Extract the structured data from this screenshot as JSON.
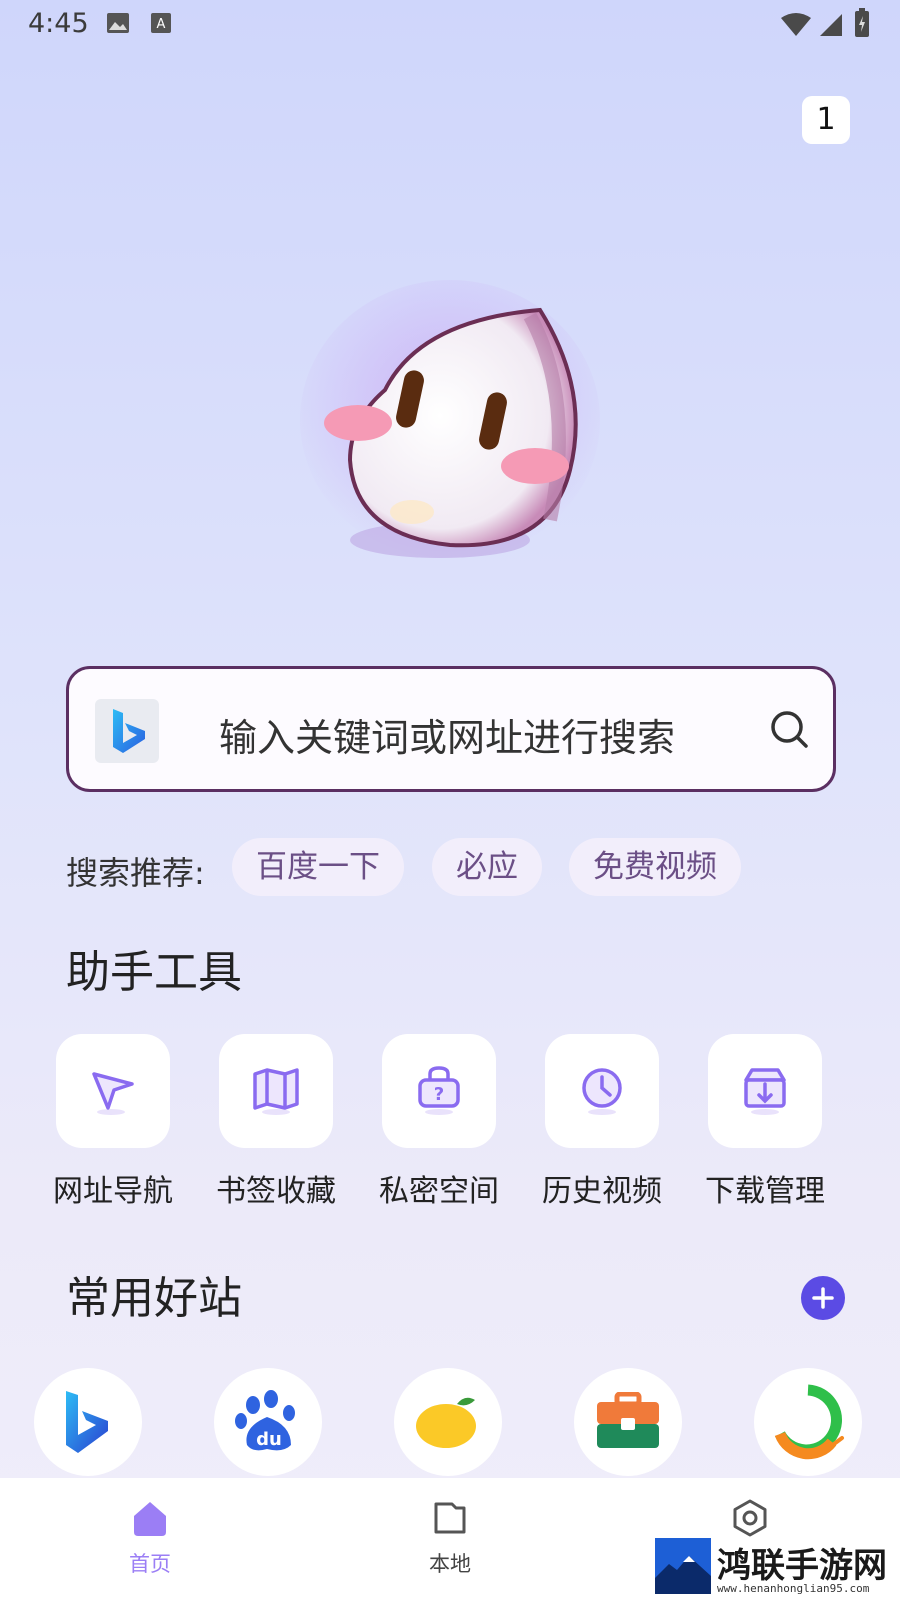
{
  "status_bar": {
    "time": "4:45",
    "icons": [
      "image-icon",
      "text-icon",
      "wifi-icon",
      "signal-icon",
      "battery-icon"
    ]
  },
  "tab_counter": "1",
  "search": {
    "placeholder": "输入关键词或网址进行搜索",
    "engine_icon": "bing-logo-icon"
  },
  "suggestions": {
    "label": "搜索推荐:",
    "chips": [
      "百度一下",
      "必应",
      "免费视频"
    ]
  },
  "tools": {
    "title": "助手工具",
    "items": [
      {
        "label": "网址导航",
        "icon": "navigation-arrow-icon"
      },
      {
        "label": "书签收藏",
        "icon": "map-bookmark-icon"
      },
      {
        "label": "私密空间",
        "icon": "lock-bag-icon"
      },
      {
        "label": "历史视频",
        "icon": "clock-icon"
      },
      {
        "label": "下载管理",
        "icon": "download-box-icon"
      }
    ]
  },
  "sites": {
    "title": "常用好站",
    "items": [
      "bing-icon",
      "baidu-icon",
      "mango-icon",
      "toolbox-icon",
      "ring-app-icon"
    ]
  },
  "bottom_nav": {
    "items": [
      {
        "label": "首页",
        "icon": "home-icon",
        "active": true
      },
      {
        "label": "本地",
        "icon": "folder-icon",
        "active": false
      },
      {
        "label": "",
        "icon": "settings-icon",
        "active": false
      }
    ]
  },
  "watermark": {
    "text": "鸿联手游网",
    "url": "www.henanhonglian95.com"
  },
  "colors": {
    "accent": "#5b4be4",
    "tool_icon": "#8a6bf0",
    "search_border": "#5b2f62",
    "nav_active": "#9b7ef5"
  }
}
